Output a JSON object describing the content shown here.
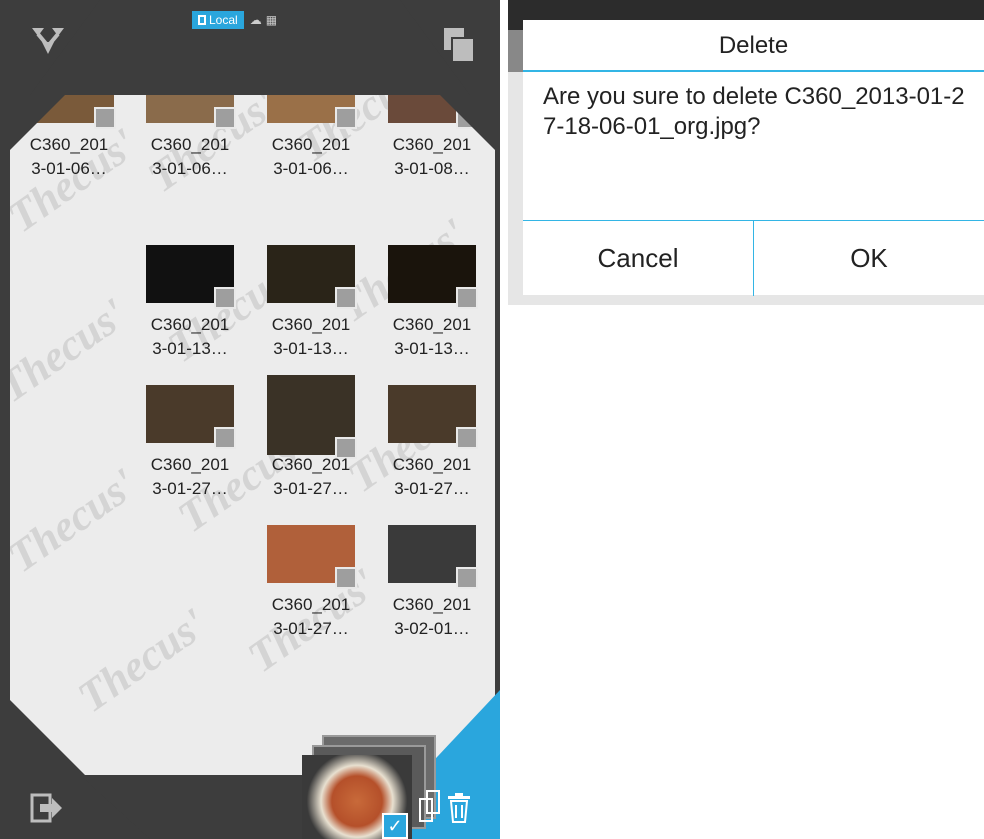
{
  "top_bar": {
    "tabs": [
      {
        "label": "Local",
        "icon": "device-icon",
        "active": true
      },
      {
        "label": "",
        "icon": "cloud-icon",
        "active": false
      }
    ]
  },
  "grid": {
    "rows": [
      {
        "items": [
          {
            "label_1": "C360_201",
            "label_2": "3-01-06…",
            "thumb": "#7a5a3a"
          },
          {
            "label_1": "C360_201",
            "label_2": "3-01-06…",
            "thumb": "#8a6b4b"
          },
          {
            "label_1": "C360_201",
            "label_2": "3-01-06…",
            "thumb": "#9a7048"
          },
          {
            "label_1": "C360_201",
            "label_2": "3-01-08…",
            "thumb": "#6a4a3a"
          }
        ]
      },
      {
        "items": [
          null,
          {
            "label_1": "C360_201",
            "label_2": "3-01-13…",
            "thumb": "#111111"
          },
          {
            "label_1": "C360_201",
            "label_2": "3-01-13…",
            "thumb": "#2a2418"
          },
          {
            "label_1": "C360_201",
            "label_2": "3-01-13…",
            "thumb": "#1a140c"
          }
        ]
      },
      {
        "items": [
          null,
          {
            "label_1": "C360_201",
            "label_2": "3-01-27…",
            "thumb": "#4a3a2a"
          },
          {
            "label_1": "C360_201",
            "label_2": "3-01-27…",
            "thumb": "#3a3226"
          },
          {
            "label_1": "C360_201",
            "label_2": "3-01-27…",
            "thumb": "#4a3a2a"
          }
        ]
      },
      {
        "items": [
          null,
          null,
          {
            "label_1": "C360_201",
            "label_2": "3-01-27…",
            "thumb": "#b0603a"
          },
          {
            "label_1": "C360_201",
            "label_2": "3-02-01…",
            "thumb": "#3a3a3a"
          }
        ]
      }
    ]
  },
  "dialog": {
    "title": "Delete",
    "message": "Are you sure to delete C360_2013-01-27-18-06-01_org.jpg?",
    "cancel_label": "Cancel",
    "ok_label": "OK"
  },
  "colors": {
    "accent": "#33b5e5",
    "frame": "#3d3d3d",
    "grid_bg": "#ececec"
  }
}
